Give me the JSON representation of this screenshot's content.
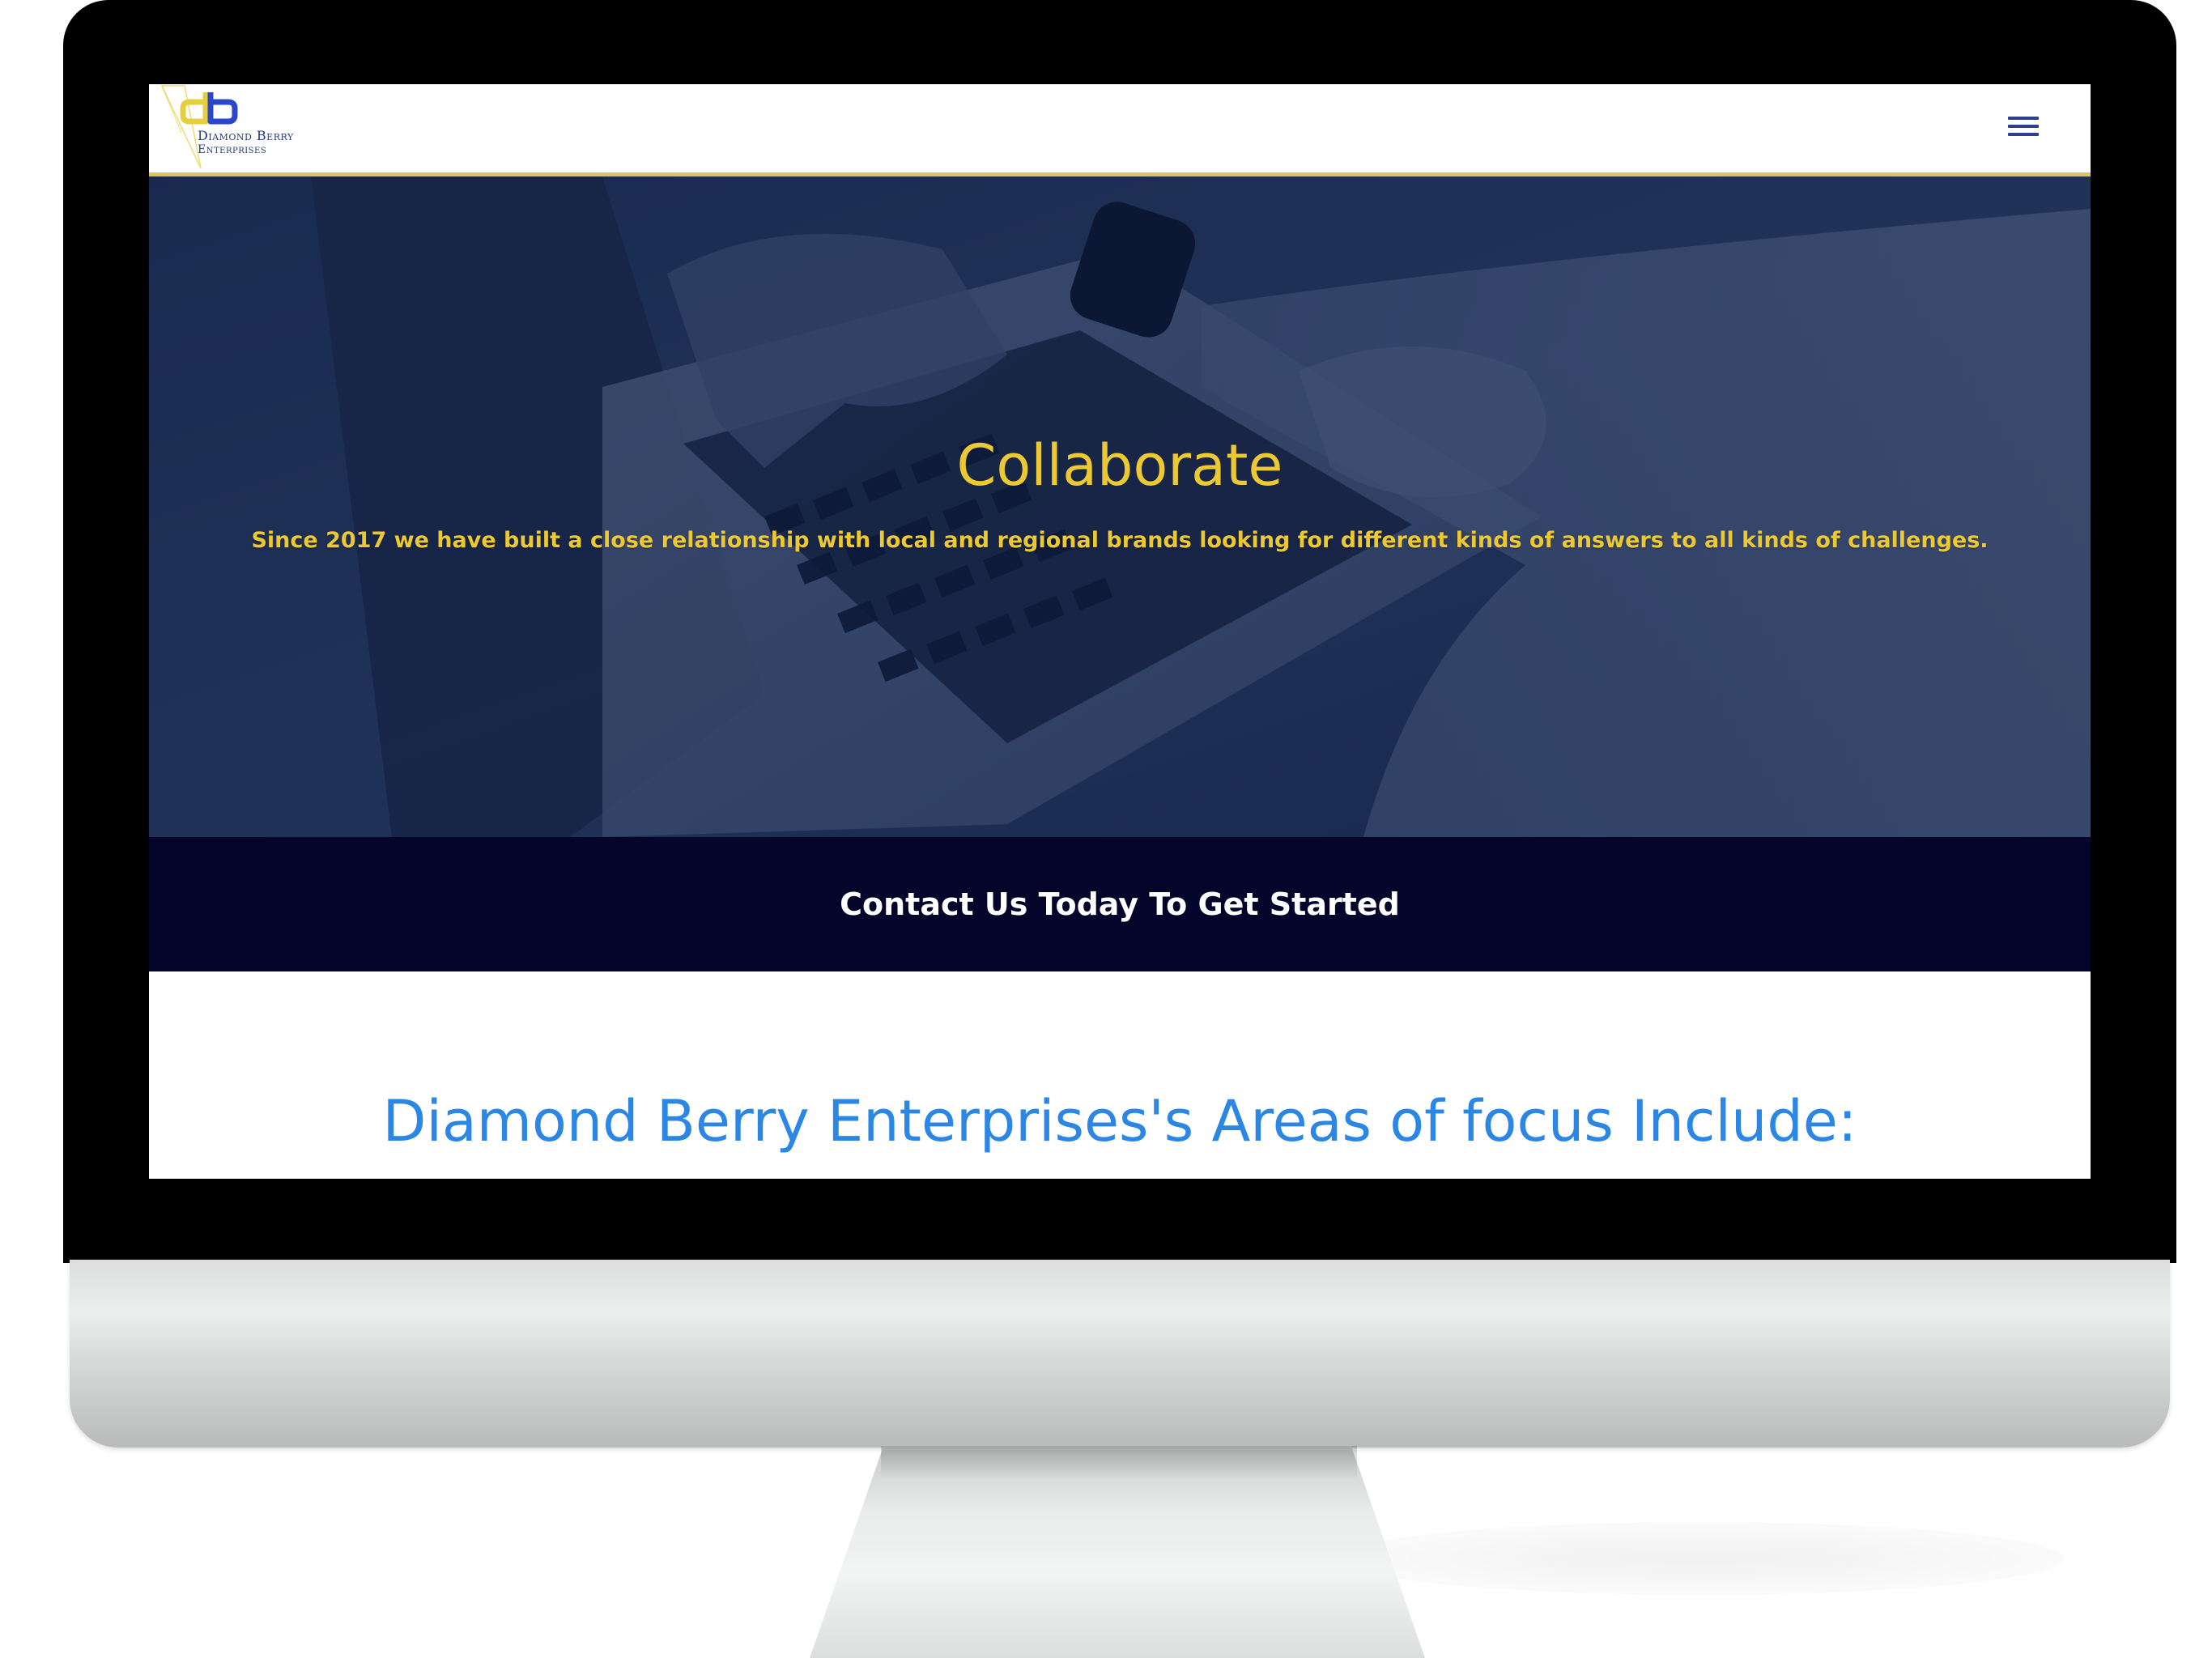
{
  "site": {
    "logo": {
      "monogram": "db",
      "line1": "Diamond Berry",
      "line2": "Enterprises",
      "gold": "#e6cf3c",
      "blue": "#2a46c9"
    },
    "menu_icon": "hamburger-menu-icon"
  },
  "hero": {
    "title": "Collaborate",
    "subtitle": "Since 2017 we have built a close relationship with local and regional brands looking for different kinds of answers to all kinds of challenges.",
    "text_color": "#ecc933",
    "overlay_color": "#0c1c40"
  },
  "cta": {
    "label": "Contact Us Today To Get Started",
    "background": "#03062a"
  },
  "focus": {
    "heading": "Diamond Berry Enterprises's Areas of focus Include:",
    "color": "#2b87e3"
  }
}
